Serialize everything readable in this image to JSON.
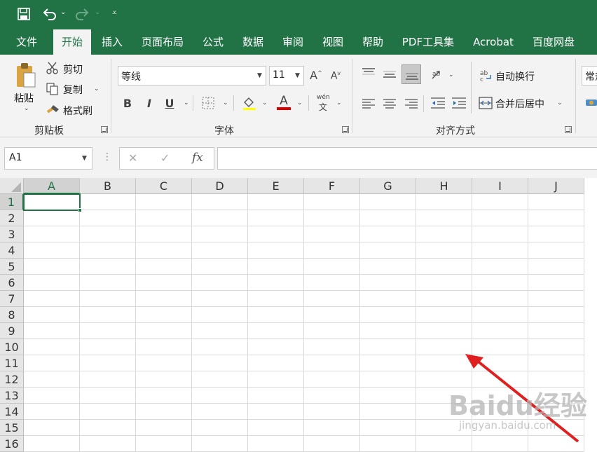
{
  "quick_access": {
    "save_icon": "save-icon",
    "undo_icon": "undo-icon",
    "redo_icon": "redo-icon",
    "customize_icon": "customize-icon"
  },
  "tabs": [
    {
      "label": "文件"
    },
    {
      "label": "开始"
    },
    {
      "label": "插入"
    },
    {
      "label": "页面布局"
    },
    {
      "label": "公式"
    },
    {
      "label": "数据"
    },
    {
      "label": "审阅"
    },
    {
      "label": "视图"
    },
    {
      "label": "帮助"
    },
    {
      "label": "PDF工具集"
    },
    {
      "label": "Acrobat"
    },
    {
      "label": "百度网盘"
    }
  ],
  "ribbon": {
    "clipboard": {
      "paste": "粘贴",
      "cut": "剪切",
      "copy": "复制",
      "format_painter": "格式刷",
      "group_label": "剪贴板"
    },
    "font": {
      "font_name": "等线",
      "font_size": "11",
      "grow": "A",
      "shrink": "A",
      "bold": "B",
      "italic": "I",
      "underline": "U",
      "font_color": "A",
      "phonetic_top": "wén",
      "phonetic_bottom": "文",
      "group_label": "字体"
    },
    "alignment": {
      "wrap_text": "自动换行",
      "merge_center": "合并后居中",
      "group_label": "对齐方式"
    },
    "number": {
      "format": "常规"
    }
  },
  "formula_bar": {
    "name_box": "A1",
    "cancel": "✕",
    "enter": "✓",
    "fx": "fx",
    "content": ""
  },
  "sheet": {
    "columns": [
      "A",
      "B",
      "C",
      "D",
      "E",
      "F",
      "G",
      "H",
      "I",
      "J"
    ],
    "rows": [
      "1",
      "2",
      "3",
      "4",
      "5",
      "6",
      "7",
      "8",
      "9",
      "10",
      "11",
      "12",
      "13",
      "14",
      "15",
      "16"
    ],
    "selected_cell": "A1"
  },
  "watermark": {
    "brand": "Baidu经验",
    "url": "jingyan.baidu.com"
  },
  "colors": {
    "accent": "#217346",
    "arrow": "#e02020",
    "font_color_bar": "#e00000"
  }
}
